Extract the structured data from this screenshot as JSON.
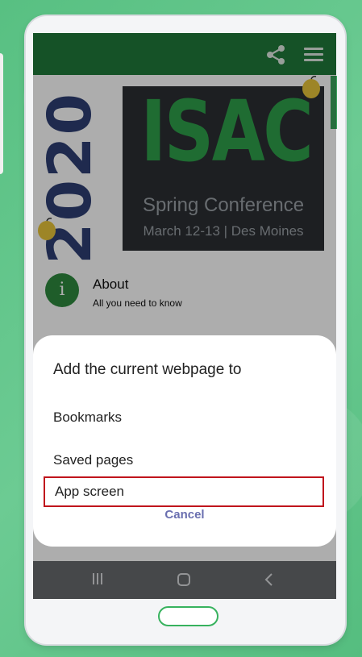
{
  "colors": {
    "background": "#5ec486",
    "header_green": "#1f7a3a",
    "accent_green": "#2ea04a",
    "year_navy": "#2e3f73",
    "highlight_red": "#c0141c",
    "cancel_link": "#6a6fb0"
  },
  "header": {
    "icons": [
      "share-icon",
      "hamburger-menu-icon"
    ]
  },
  "banner": {
    "year": "2020",
    "title": "ISAC",
    "subtitle": "Spring Conference",
    "date": "March 12-13 | Des Moines"
  },
  "list": {
    "items": [
      {
        "icon": "info-icon",
        "icon_glyph": "i",
        "title": "About",
        "subtitle": "All you need to know"
      }
    ]
  },
  "dialog": {
    "title": "Add the current webpage to",
    "options": [
      "Bookmarks",
      "Saved pages",
      "App screen"
    ],
    "highlighted_option": "App screen",
    "cancel_label": "Cancel"
  },
  "navbar": {
    "icons": [
      "recents-icon",
      "home-icon",
      "back-icon"
    ]
  }
}
